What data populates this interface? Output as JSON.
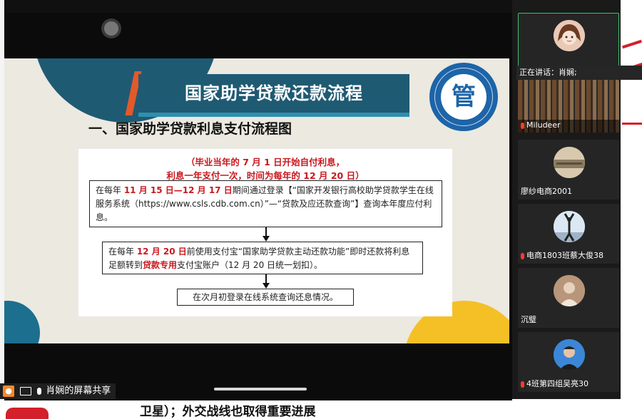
{
  "slide": {
    "banner_title": "国家助学贷款还款流程",
    "section_title": "一、国家助学贷款利息支付流程图",
    "note_line1": "（毕业当年的 7 月 1 日开始自付利息，",
    "note_line2": "利息一年支付一次，时间为每年的 12 月 20 日）",
    "box1": {
      "pre": "在每年 ",
      "date": "11 月 15 日—12 月 17 日",
      "post": "期间通过登录【“国家开发银行高校助学贷款学生在线服务系统（https://www.csls.cdb.com.cn）”—“贷款及应还款查询”】查询本年度应付利息。"
    },
    "box2": {
      "pre": "在每年 ",
      "date": "12 月 20 日",
      "mid": "前使用支付宝“国家助学贷款主动还款功能”即时还款将利息足额转到",
      "highlight": "贷款专用",
      "post": "支付宝账户（12 月 20 日统一划扣）。"
    },
    "box3": "在次月初登录在线系统查询还息情况。",
    "logo_glyph": "管"
  },
  "presenter": {
    "share_label": "肖娴的屏幕共享"
  },
  "speaking": "正在讲话：肖娴;",
  "participants": [
    {
      "name": ""
    },
    {
      "name": "Miludeer"
    },
    {
      "name": "廖纱电商2001"
    },
    {
      "name": "电商1803班蔡大俊38"
    },
    {
      "name": "沉璧"
    },
    {
      "name": "4班第四组吴亮30"
    }
  ],
  "caption": "卫星）；外交战线也取得重要进展",
  "colors": {
    "banner": "#1f5a73",
    "accent_red": "#c8181e",
    "deco_yellow": "#f5c026",
    "logo_blue": "#1d64a8"
  }
}
